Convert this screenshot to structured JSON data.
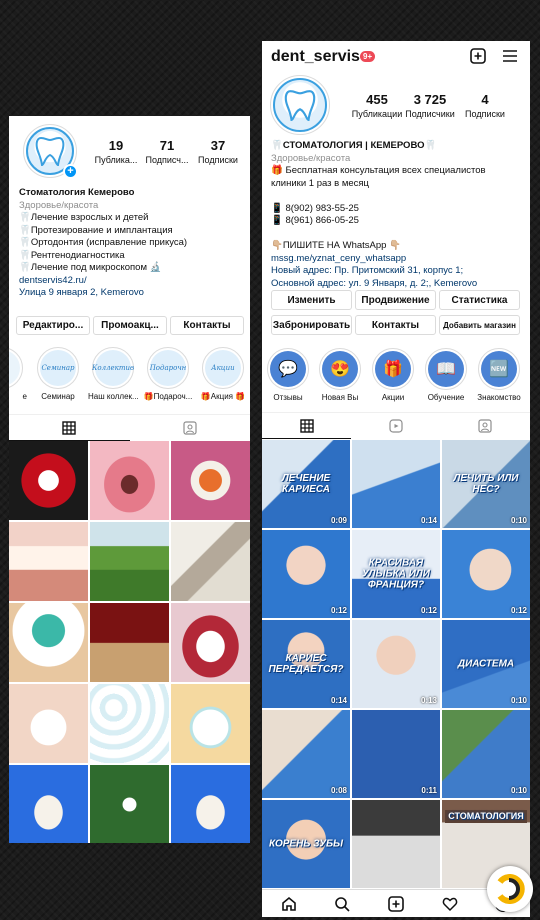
{
  "left": {
    "stats": [
      {
        "num": "19",
        "label": "Публика..."
      },
      {
        "num": "71",
        "label": "Подписч..."
      },
      {
        "num": "37",
        "label": "Подписки"
      }
    ],
    "name": "Стоматология Кемерово",
    "category": "Здоровье/красота",
    "bio": [
      "Лечение взрослых и детей",
      "Протезирование и имплантация",
      "Ортодонтия (исправление прикуса)",
      "Рентгенодиагностика",
      "Лечение под микроскопом 🔬"
    ],
    "link": "dentservis42.ru/",
    "address": "Улица 9 января 2, Kemerovo",
    "buttons": [
      "Редактиро...",
      "Промоакц...",
      "Контакты"
    ],
    "highlights": [
      {
        "label": "е",
        "art": ""
      },
      {
        "label": "Семинар",
        "art": "Семинар"
      },
      {
        "label": "Наш коллек...",
        "art": "Коллектив"
      },
      {
        "label": "🎁Подароч...",
        "art": "Подарочн"
      },
      {
        "label": "🎁Акция 🎁",
        "art": "Акции"
      }
    ]
  },
  "right": {
    "username": "dent_servis",
    "badge": "9+",
    "stats": [
      {
        "num": "455",
        "label": "Публикации"
      },
      {
        "num": "3 725",
        "label": "Подписчики"
      },
      {
        "num": "4",
        "label": "Подписки"
      }
    ],
    "bio_title": "🦷СТОМАТОЛОГИЯ | КЕМЕРОВО🦷",
    "category": "Здоровье/красота",
    "bio": [
      "🎁 Бесплатная консультация всех специалистов",
      "клиники 1 раз в месяц",
      "",
      "📱 8(902) 983-55-25",
      "📱 8(961) 866-05-25",
      "",
      "👇🏼ПИШИТЕ НА WhatsApp 👇🏼"
    ],
    "link": "mssg.me/yznat_ceny_whatsapp",
    "address_1": "Новый адрес: Пр. Притомский 31, корпус 1;",
    "address_2": "Основной адрес: ул. 9 Января, д. 2;, Kemerovo",
    "buttons": [
      "Изменить",
      "Продвижение",
      "Статистика",
      "Забронировать",
      "Контакты",
      "Добавить магазин"
    ],
    "highlights": [
      {
        "label": "Отзывы",
        "icon": "💬"
      },
      {
        "label": "Новая Вы",
        "icon": "😍"
      },
      {
        "label": "Акции",
        "icon": "🎁"
      },
      {
        "label": "Обучение",
        "icon": "📖"
      },
      {
        "label": "Знакомство",
        "icon": "🆕"
      }
    ],
    "posts": [
      {
        "text": "ЛЕЧЕНИЕ КАРИЕСА",
        "dur": "0:09"
      },
      {
        "text": "",
        "dur": "0:14"
      },
      {
        "text": "ЛЕЧИТЬ ИЛИ НЕС?",
        "dur": "0:10"
      },
      {
        "text": "",
        "dur": "0:12"
      },
      {
        "text": "КРАСИВАЯ УЛЫБКА ИЛИ ФРАНЦИЯ?",
        "dur": "0:12"
      },
      {
        "text": "",
        "dur": "0:12"
      },
      {
        "text": "КАРИЕС ПЕРЕДАЕТСЯ?",
        "dur": "0:14"
      },
      {
        "text": "",
        "dur": "0:13"
      },
      {
        "text": "ДИАСТЕМА",
        "dur": "0:10"
      },
      {
        "text": "",
        "dur": "0:08"
      },
      {
        "text": "",
        "dur": "0:11"
      },
      {
        "text": "",
        "dur": "0:10"
      },
      {
        "text": "КОРЕНЬ ЗУБЫ",
        "dur": ""
      },
      {
        "text": "",
        "dur": ""
      },
      {
        "text": "СТОМАТОЛОГИЯ",
        "dur": ""
      }
    ]
  },
  "colors": {
    "accent": "#0095f6",
    "link": "#00376b",
    "badge": "#ed4956",
    "post_blue": "#2f7fcf"
  }
}
